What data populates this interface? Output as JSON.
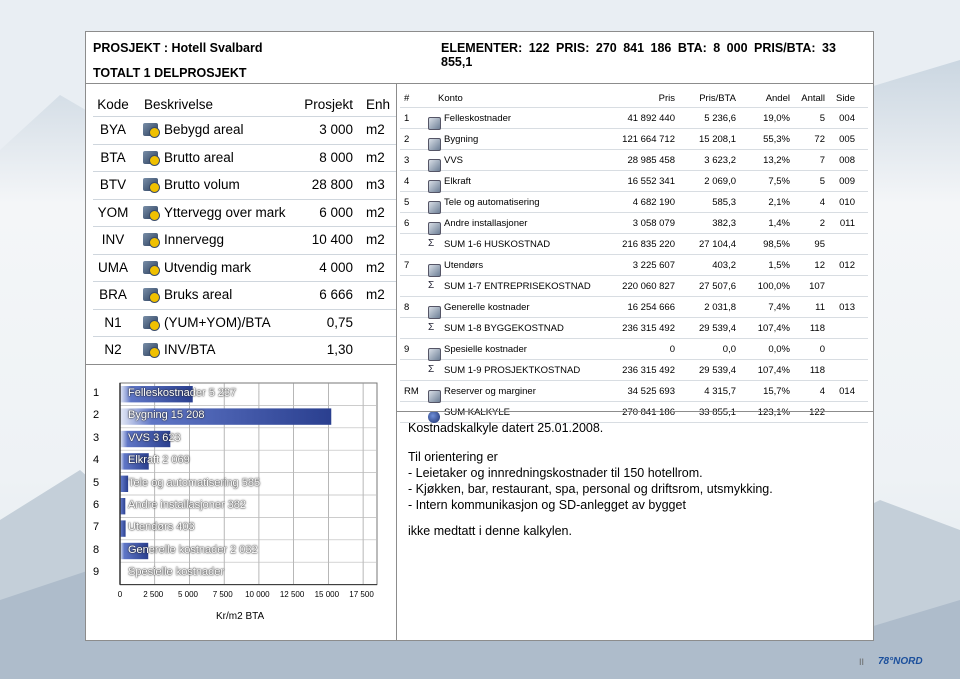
{
  "header": {
    "project": "PROSJEKT : Hotell Svalbard",
    "summary": "ELEMENTER: 122 PRIS: 270 841 186 BTA: 8 000 PRIS/BTA: 33 855,1",
    "total": "TOTALT 1 DELPROSJEKT"
  },
  "left_table": {
    "headers": {
      "code": "Kode",
      "desc": "Beskrivelse",
      "val": "Prosjekt",
      "unit": "Enh"
    },
    "rows": [
      {
        "code": "BYA",
        "desc": "Bebygd areal",
        "val": "3 000",
        "unit": "m2"
      },
      {
        "code": "BTA",
        "desc": "Brutto areal",
        "val": "8 000",
        "unit": "m2"
      },
      {
        "code": "BTV",
        "desc": "Brutto volum",
        "val": "28 800",
        "unit": "m3"
      },
      {
        "code": "YOM",
        "desc": "Yttervegg over mark",
        "val": "6 000",
        "unit": "m2"
      },
      {
        "code": "INV",
        "desc": "Innervegg",
        "val": "10 400",
        "unit": "m2"
      },
      {
        "code": "UMA",
        "desc": "Utvendig mark",
        "val": "4 000",
        "unit": "m2"
      },
      {
        "code": "BRA",
        "desc": "Bruks areal",
        "val": "6 666",
        "unit": "m2"
      },
      {
        "code": "N1",
        "desc": "(YUM+YOM)/BTA",
        "val": "0,75",
        "unit": ""
      },
      {
        "code": "N2",
        "desc": "INV/BTA",
        "val": "1,30",
        "unit": ""
      }
    ]
  },
  "chart_data": {
    "type": "bar",
    "orientation": "horizontal",
    "row_numbers": [
      "1",
      "2",
      "3",
      "4",
      "5",
      "6",
      "7",
      "8",
      "9"
    ],
    "categories": [
      "Felleskostnader",
      "Bygning",
      "VVS",
      "Elkraft",
      "Tele og automatisering",
      "Andre installasjoner",
      "Utendørs",
      "Generelle kostnader",
      "Spesielle kostnader"
    ],
    "bar_labels": [
      "Felleskostnader 5 237",
      "Bygning 15 208",
      "VVS 3 623",
      "Elkraft 2 069",
      "Tele og automatisering 585",
      "Andre installasjoner 382",
      "Utendørs 403",
      "Generelle kostnader 2 032",
      "Spesielle kostnader"
    ],
    "values": [
      5237,
      15208,
      3623,
      2069,
      585,
      382,
      403,
      2032,
      0
    ],
    "xlim": [
      0,
      18500
    ],
    "xticks": [
      "0",
      "2 500",
      "5 000",
      "7 500",
      "10 000",
      "12 500",
      "15 000",
      "17 500"
    ],
    "xtick_values": [
      0,
      2500,
      5000,
      7500,
      10000,
      12500,
      15000,
      17500
    ],
    "xlabel": "Kr/m2 BTA",
    "bar_color": "#2a3f8f",
    "grid": true
  },
  "right_table": {
    "headers": {
      "n": "#",
      "konto": "Konto",
      "pris": "Pris",
      "prisbta": "Pris/BTA",
      "andel": "Andel",
      "antall": "Antall",
      "side": "Side"
    },
    "rows": [
      {
        "n": "1",
        "icon": "doc",
        "konto": "Felleskostnader",
        "pris": "41 892 440",
        "prisbta": "5 236,6",
        "andel": "19,0%",
        "antall": "5",
        "side": "004"
      },
      {
        "n": "2",
        "icon": "doc",
        "konto": "Bygning",
        "pris": "121 664 712",
        "prisbta": "15 208,1",
        "andel": "55,3%",
        "antall": "72",
        "side": "005"
      },
      {
        "n": "3",
        "icon": "doc",
        "konto": "VVS",
        "pris": "28 985 458",
        "prisbta": "3 623,2",
        "andel": "13,2%",
        "antall": "7",
        "side": "008"
      },
      {
        "n": "4",
        "icon": "doc",
        "konto": "Elkraft",
        "pris": "16 552 341",
        "prisbta": "2 069,0",
        "andel": "7,5%",
        "antall": "5",
        "side": "009"
      },
      {
        "n": "5",
        "icon": "doc",
        "konto": "Tele og automatisering",
        "pris": "4 682 190",
        "prisbta": "585,3",
        "andel": "2,1%",
        "antall": "4",
        "side": "010"
      },
      {
        "n": "6",
        "icon": "doc",
        "konto": "Andre installasjoner",
        "pris": "3 058 079",
        "prisbta": "382,3",
        "andel": "1,4%",
        "antall": "2",
        "side": "011"
      },
      {
        "n": "",
        "icon": "sigma",
        "konto": "SUM 1-6 HUSKOSTNAD",
        "pris": "216 835 220",
        "prisbta": "27 104,4",
        "andel": "98,5%",
        "antall": "95",
        "side": ""
      },
      {
        "n": "7",
        "icon": "doc",
        "konto": "Utendørs",
        "pris": "3 225 607",
        "prisbta": "403,2",
        "andel": "1,5%",
        "antall": "12",
        "side": "012"
      },
      {
        "n": "",
        "icon": "sigma",
        "konto": "SUM 1-7 ENTREPRISEKOSTNAD",
        "pris": "220 060 827",
        "prisbta": "27 507,6",
        "andel": "100,0%",
        "antall": "107",
        "side": ""
      },
      {
        "n": "8",
        "icon": "doc",
        "konto": "Generelle kostnader",
        "pris": "16 254 666",
        "prisbta": "2 031,8",
        "andel": "7,4%",
        "antall": "11",
        "side": "013"
      },
      {
        "n": "",
        "icon": "sigma",
        "konto": "SUM 1-8 BYGGEKOSTNAD",
        "pris": "236 315 492",
        "prisbta": "29 539,4",
        "andel": "107,4%",
        "antall": "118",
        "side": ""
      },
      {
        "n": "9",
        "icon": "doc",
        "konto": "Spesielle kostnader",
        "pris": "0",
        "prisbta": "0,0",
        "andel": "0,0%",
        "antall": "0",
        "side": ""
      },
      {
        "n": "",
        "icon": "sigma",
        "konto": "SUM 1-9 PROSJEKTKOSTNAD",
        "pris": "236 315 492",
        "prisbta": "29 539,4",
        "andel": "107,4%",
        "antall": "118",
        "side": ""
      },
      {
        "n": "RM",
        "icon": "doc",
        "konto": "Reserver og marginer",
        "pris": "34 525 693",
        "prisbta": "4 315,7",
        "andel": "15,7%",
        "antall": "4",
        "side": "014"
      },
      {
        "n": "",
        "icon": "globe",
        "konto": "SUM KALKYLE",
        "pris": "270 841 186",
        "prisbta": "33 855,1",
        "andel": "123,1%",
        "antall": "122",
        "side": ""
      }
    ]
  },
  "notes": {
    "dated": "Kostnadskalkyle datert 25.01.2008.",
    "heading": "Til orientering er",
    "items": [
      "- Leietaker og innredningskostnader til 150 hotellrom.",
      "- Kjøkken, bar, restaurant, spa, personal og  driftsrom, utsmykking.",
      "- Intern kommunikasjon og SD-anlegget av bygget"
    ],
    "footer": "ikke medtatt i denne kalkylen."
  },
  "footer": {
    "page": "II",
    "logo": "78°NORD"
  }
}
